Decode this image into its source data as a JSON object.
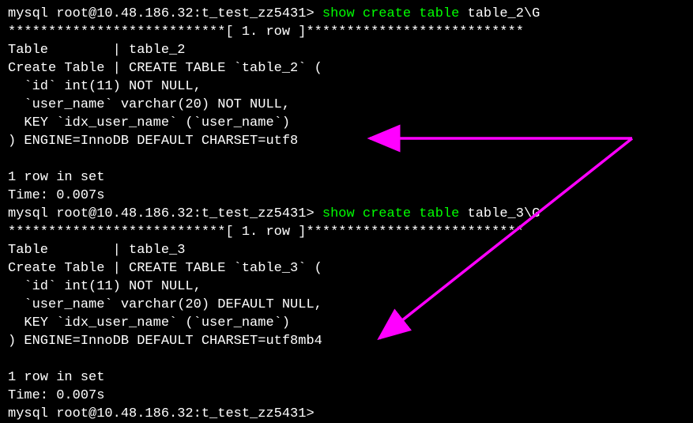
{
  "blocks": [
    {
      "prompt": "mysql root@10.48.186.32:t_test_zz5431> ",
      "command": "show create table ",
      "table": "table_2\\G",
      "separator": "***************************[ 1. row ]***************************",
      "output_lines": [
        "Table        | table_2",
        "Create Table | CREATE TABLE `table_2` (",
        "  `id` int(11) NOT NULL,",
        "  `user_name` varchar(20) NOT NULL,",
        "  KEY `idx_user_name` (`user_name`)",
        ") ENGINE=InnoDB DEFAULT CHARSET=utf8",
        "",
        "1 row in set",
        "Time: 0.007s"
      ]
    },
    {
      "prompt": "mysql root@10.48.186.32:t_test_zz5431> ",
      "command": "show create table ",
      "table": "table_3\\G",
      "separator": "***************************[ 1. row ]***************************",
      "output_lines": [
        "Table        | table_3",
        "Create Table | CREATE TABLE `table_3` (",
        "  `id` int(11) NOT NULL,",
        "  `user_name` varchar(20) DEFAULT NULL,",
        "  KEY `idx_user_name` (`user_name`)",
        ") ENGINE=InnoDB DEFAULT CHARSET=utf8mb4",
        "",
        "1 row in set",
        "Time: 0.007s"
      ]
    }
  ],
  "final_prompt": "mysql root@10.48.186.32:t_test_zz5431> ",
  "arrow_color": "#ff00ff"
}
